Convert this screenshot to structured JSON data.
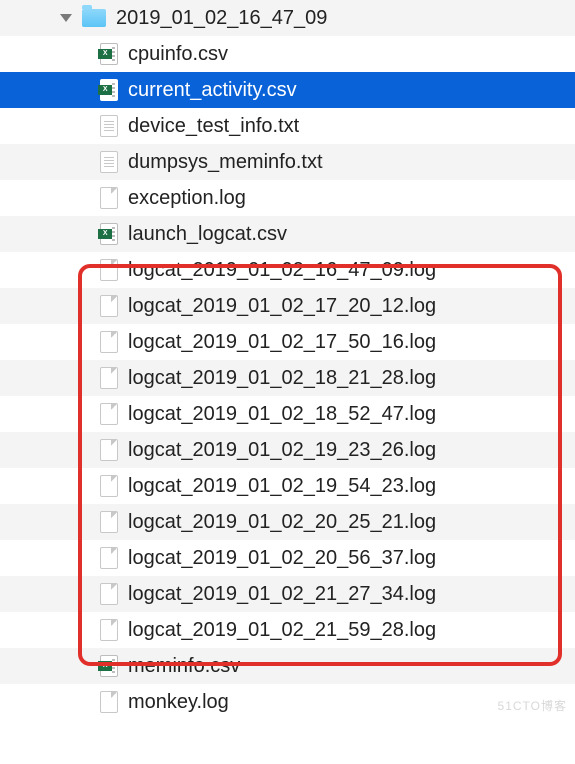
{
  "folder": {
    "name": "2019_01_02_16_47_09"
  },
  "files": [
    {
      "name": "cpuinfo.csv",
      "icon": "csv",
      "selected": false
    },
    {
      "name": "current_activity.csv",
      "icon": "csv",
      "selected": true
    },
    {
      "name": "device_test_info.txt",
      "icon": "txt",
      "selected": false
    },
    {
      "name": "dumpsys_meminfo.txt",
      "icon": "txt",
      "selected": false
    },
    {
      "name": "exception.log",
      "icon": "doc",
      "selected": false
    },
    {
      "name": "launch_logcat.csv",
      "icon": "csv",
      "selected": false
    },
    {
      "name": "logcat_2019_01_02_16_47_09.log",
      "icon": "doc",
      "selected": false
    },
    {
      "name": "logcat_2019_01_02_17_20_12.log",
      "icon": "doc",
      "selected": false
    },
    {
      "name": "logcat_2019_01_02_17_50_16.log",
      "icon": "doc",
      "selected": false
    },
    {
      "name": "logcat_2019_01_02_18_21_28.log",
      "icon": "doc",
      "selected": false
    },
    {
      "name": "logcat_2019_01_02_18_52_47.log",
      "icon": "doc",
      "selected": false
    },
    {
      "name": "logcat_2019_01_02_19_23_26.log",
      "icon": "doc",
      "selected": false
    },
    {
      "name": "logcat_2019_01_02_19_54_23.log",
      "icon": "doc",
      "selected": false
    },
    {
      "name": "logcat_2019_01_02_20_25_21.log",
      "icon": "doc",
      "selected": false
    },
    {
      "name": "logcat_2019_01_02_20_56_37.log",
      "icon": "doc",
      "selected": false
    },
    {
      "name": "logcat_2019_01_02_21_27_34.log",
      "icon": "doc",
      "selected": false
    },
    {
      "name": "logcat_2019_01_02_21_59_28.log",
      "icon": "doc",
      "selected": false
    },
    {
      "name": "meminfo.csv",
      "icon": "csv",
      "selected": false
    },
    {
      "name": "monkey.log",
      "icon": "doc",
      "selected": false
    }
  ],
  "highlight_range": {
    "start_index": 6,
    "end_index": 16
  },
  "watermark": "51CTO博客"
}
